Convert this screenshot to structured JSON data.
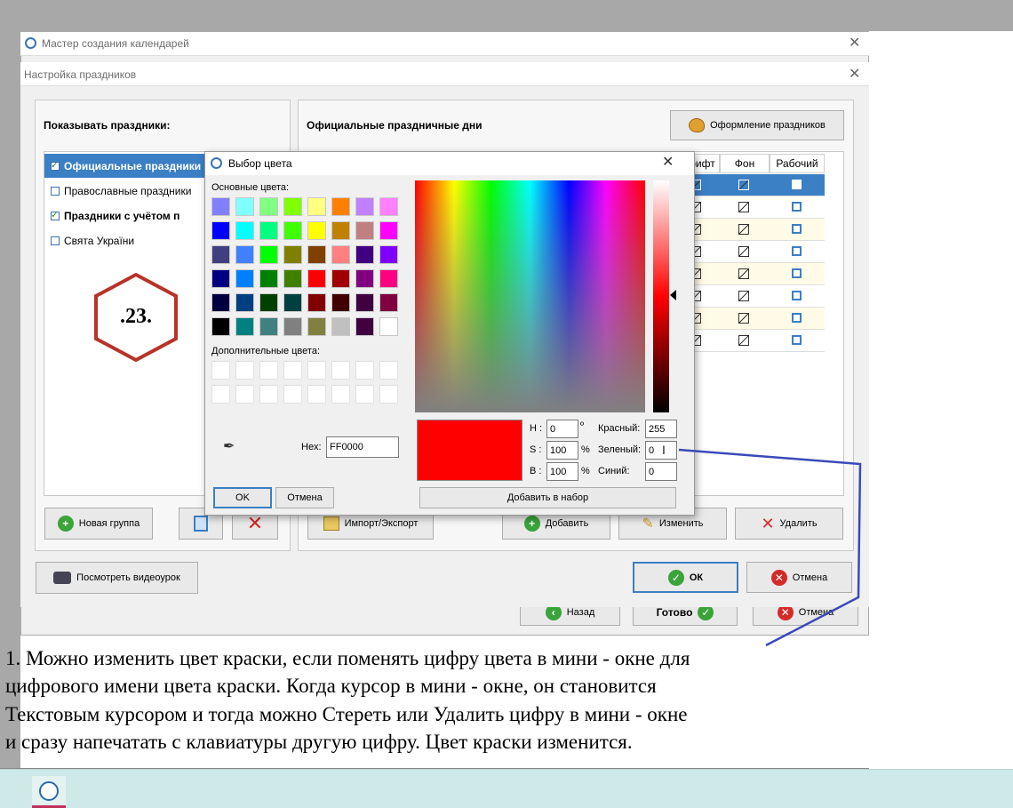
{
  "wizard": {
    "title": "Мастер создания календарей",
    "close_icon": "close-icon"
  },
  "holiday_dialog": {
    "title": "Настройка праздников",
    "show_holidays_label": "Показывать праздники:",
    "list_items": [
      {
        "label": "Официальные праздники",
        "checked": true,
        "bold": true,
        "selected": true
      },
      {
        "label": "Православные праздники",
        "checked": false,
        "bold": false,
        "selected": false
      },
      {
        "label": "Праздники с учётом п",
        "checked": true,
        "bold": true,
        "selected": false
      },
      {
        "label": "Свята України",
        "checked": false,
        "bold": false,
        "selected": false
      }
    ],
    "official_days_label": "Официальные праздничные дни",
    "design_button": "Оформление праздников",
    "table_headers": [
      "Шрифт",
      "Фон",
      "Рабочий"
    ],
    "new_group_button": "Новая группа",
    "import_export_button": "Импорт/Экспорт",
    "add_button": "Добавить",
    "edit_button": "Изменить",
    "delete_button": "Удалить",
    "video_button": "Посмотреть видеоурок",
    "ok_button": "ОК",
    "cancel_button": "Отмена"
  },
  "wizard_footer": {
    "back_button": "Назад",
    "done_button": "Готово",
    "cancel_button": "Отмена"
  },
  "color_dialog": {
    "title": "Выбор цвета",
    "basic_colors_label": "Основные цвета:",
    "custom_colors_label": "Дополнительные цвета:",
    "hex_label": "Hex:",
    "hex_value": "FF0000",
    "h_label": "H :",
    "h_value": "0",
    "h_unit": "º",
    "s_label": "S :",
    "s_value": "100",
    "s_unit": "%",
    "b_label": "B :",
    "b_value": "100",
    "b_unit": "%",
    "red_label": "Красный:",
    "red_value": "255",
    "green_label": "Зеленый:",
    "green_value": "0",
    "blue_label": "Синий:",
    "blue_value": "0",
    "ok_button": "OK",
    "cancel_button": "Отмена",
    "add_to_set_button": "Добавить в набор",
    "preview_color": "#ff0000",
    "basic_colors": [
      [
        "#8080ff",
        "#80ffff",
        "#80ff80",
        "#80ff00",
        "#ffff80",
        "#ff8000",
        "#c080ff",
        "#ff80ff"
      ],
      [
        "#0000ff",
        "#00ffff",
        "#00ff80",
        "#40ff00",
        "#ffff00",
        "#c08000",
        "#c08080",
        "#ff00ff"
      ],
      [
        "#404080",
        "#4080ff",
        "#00ff00",
        "#808000",
        "#804000",
        "#ff8080",
        "#400080",
        "#8000ff"
      ],
      [
        "#000080",
        "#0080ff",
        "#008000",
        "#408000",
        "#ff0000",
        "#a00000",
        "#800080",
        "#ff0080"
      ],
      [
        "#000040",
        "#004080",
        "#004000",
        "#004040",
        "#800000",
        "#400000",
        "#400040",
        "#800040"
      ],
      [
        "#000000",
        "#008080",
        "#408080",
        "#808080",
        "#808040",
        "#c0c0c0",
        "#400040",
        "#ffffff"
      ]
    ]
  },
  "badge": {
    "text": ".23."
  },
  "caption_lines": [
    "1. Можно изменить цвет краски, если поменять цифру цвета в мини - окне для",
    "  цифрового имени цвета краски. Когда курсор в мини - окне, он становится",
    " Текстовым курсором и тогда можно Стереть или Удалить цифру в мини - окне",
    "и сразу напечатать с клавиатуры другую цифру. Цвет краски изменится."
  ]
}
